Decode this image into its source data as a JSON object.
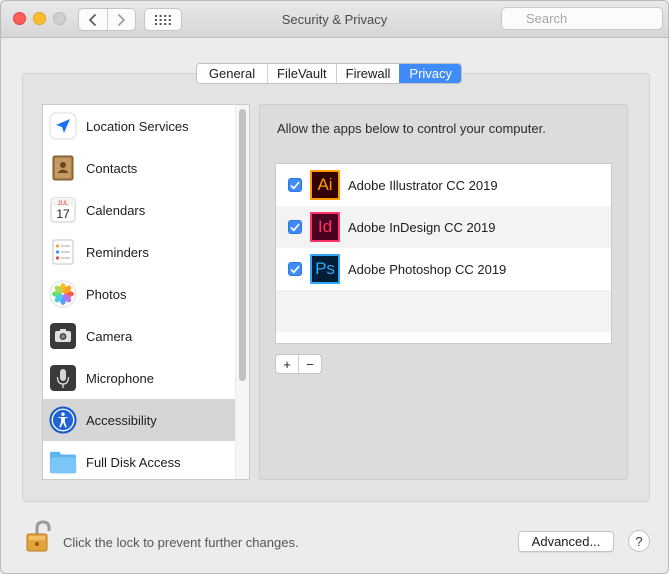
{
  "window": {
    "title": "Security & Privacy"
  },
  "toolbar": {
    "back_icon": "chevron-left-icon",
    "forward_icon": "chevron-right-icon",
    "grid_icon": "grid-icon"
  },
  "search": {
    "placeholder": "Search",
    "value": ""
  },
  "tabs": [
    {
      "label": "General",
      "active": false
    },
    {
      "label": "FileVault",
      "active": false
    },
    {
      "label": "Firewall",
      "active": false
    },
    {
      "label": "Privacy",
      "active": true
    }
  ],
  "sidebar": {
    "items": [
      {
        "label": "Location Services",
        "icon": "location-arrow-icon"
      },
      {
        "label": "Contacts",
        "icon": "contacts-book-icon"
      },
      {
        "label": "Calendars",
        "icon": "calendar-icon",
        "icon_text": {
          "month": "JUL",
          "day": "17"
        }
      },
      {
        "label": "Reminders",
        "icon": "reminders-list-icon"
      },
      {
        "label": "Photos",
        "icon": "photos-flower-icon"
      },
      {
        "label": "Camera",
        "icon": "camera-icon"
      },
      {
        "label": "Microphone",
        "icon": "microphone-icon"
      },
      {
        "label": "Accessibility",
        "icon": "accessibility-icon",
        "selected": true
      },
      {
        "label": "Full Disk Access",
        "icon": "folder-icon"
      }
    ]
  },
  "privacy_pane": {
    "description": "Allow the apps below to control your computer.",
    "apps": [
      {
        "name": "Adobe Illustrator CC 2019",
        "checked": true,
        "icon_text": "Ai",
        "icon": "illustrator-icon",
        "fg": "#ff9a00",
        "bg": "#330000"
      },
      {
        "name": "Adobe InDesign CC 2019",
        "checked": true,
        "icon_text": "Id",
        "icon": "indesign-icon",
        "fg": "#ff3366",
        "bg": "#49021f"
      },
      {
        "name": "Adobe Photoshop CC 2019",
        "checked": true,
        "icon_text": "Ps",
        "icon": "photoshop-icon",
        "fg": "#31a8ff",
        "bg": "#001e36"
      }
    ],
    "add_label": "+",
    "remove_label": "−"
  },
  "footer": {
    "lock_text": "Click the lock to prevent further changes.",
    "advanced_label": "Advanced...",
    "help_label": "?"
  },
  "colors": {
    "accent": "#3f8bf7",
    "close": "#fe5f57",
    "minimize": "#febc2e"
  }
}
